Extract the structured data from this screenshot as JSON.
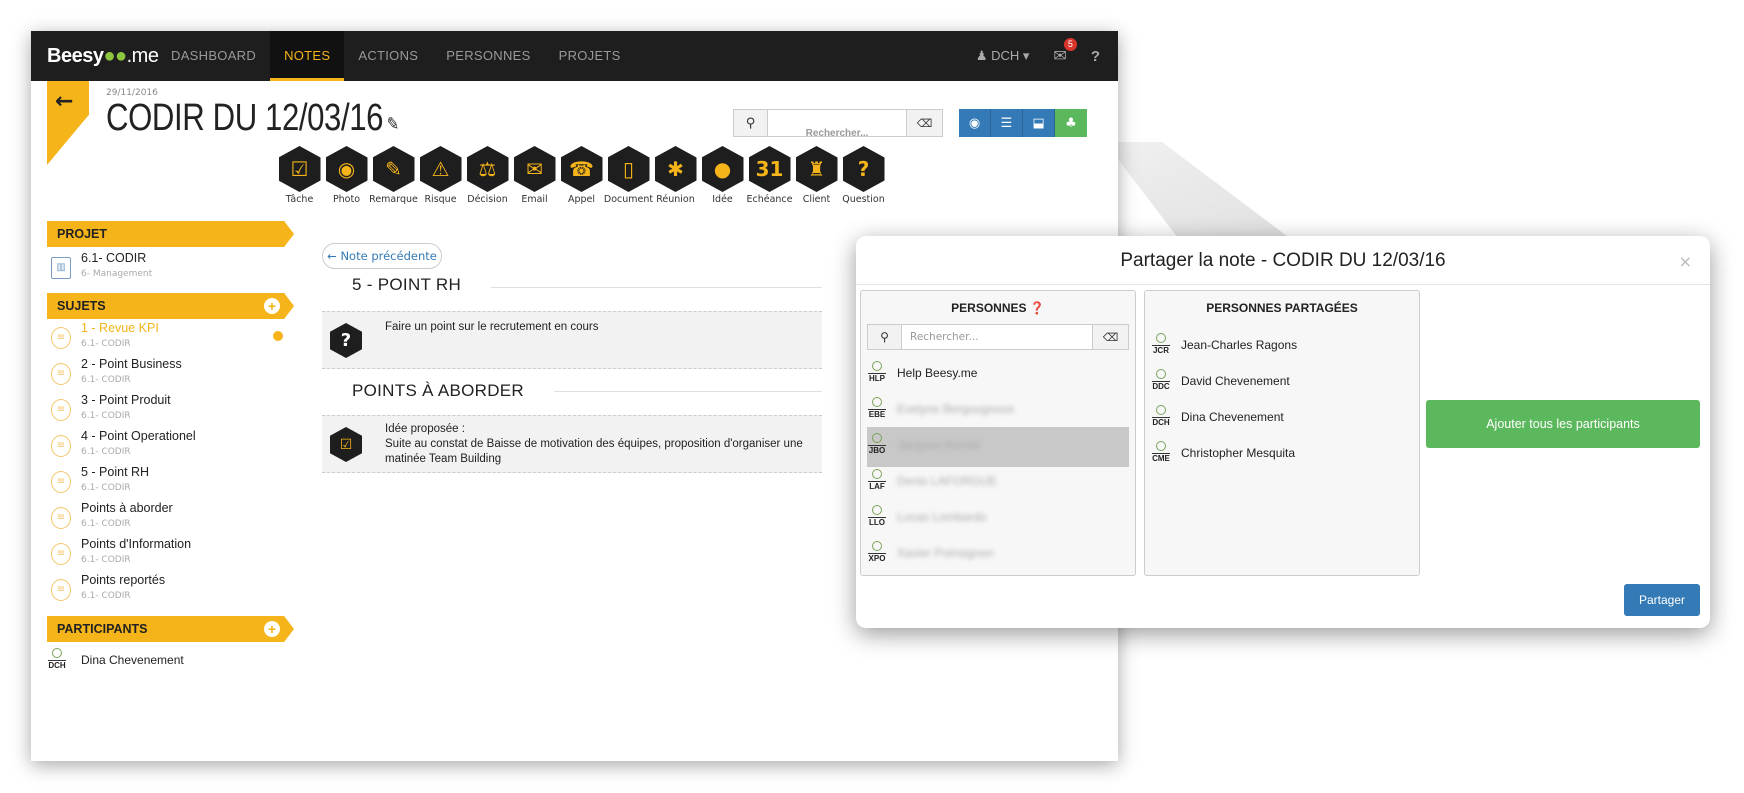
{
  "nav": {
    "logo": "Beesy",
    "logo_dots": "●●",
    "logo_me": ".me",
    "items": [
      "DASHBOARD",
      "NOTES",
      "ACTIONS",
      "PERSONNES",
      "PROJETS"
    ],
    "active": "NOTES",
    "user": "DCH ▾",
    "mail_count": "5"
  },
  "header": {
    "date": "29/11/2016",
    "title": "CODIR DU 12/03/16",
    "search_placeholder": "Rechercher..."
  },
  "tools": [
    "Tâche",
    "Photo",
    "Remarque",
    "Risque",
    "Décision",
    "Email",
    "Appel",
    "Document",
    "Réunion",
    "Idée",
    "Echéance",
    "Client",
    "Question"
  ],
  "tool_glyphs": [
    "☑",
    "◉",
    "✎",
    "⚠",
    "⚖",
    "✉",
    "☎",
    "▯",
    "✱",
    "●",
    "31",
    "♜",
    "?"
  ],
  "sidebar": {
    "projet_label": "PROJET",
    "projet_name": "6.1- CODIR",
    "projet_sub": "6- Management",
    "sujets_label": "SUJETS",
    "sujets": [
      {
        "name": "1 - Revue KPI",
        "sub": "6.1- CODIR"
      },
      {
        "name": "2 - Point Business",
        "sub": "6.1- CODIR"
      },
      {
        "name": "3 - Point Produit",
        "sub": "6.1- CODIR"
      },
      {
        "name": "4 - Point Operationel",
        "sub": "6.1- CODIR"
      },
      {
        "name": "5 - Point RH",
        "sub": "6.1- CODIR"
      },
      {
        "name": "Points à aborder",
        "sub": "6.1- CODIR"
      },
      {
        "name": "Points d'Information",
        "sub": "6.1- CODIR"
      },
      {
        "name": "Points reportés",
        "sub": "6.1- CODIR"
      }
    ],
    "participants_label": "PARTICIPANTS",
    "participant": {
      "initials": "DCH",
      "name": "Dina Chevenement"
    }
  },
  "main": {
    "prev_note": "← Note précédente",
    "section1": "5 - POINT RH",
    "card1_text": "Faire un point sur le recrutement en cours",
    "section2": "POINTS À ABORDER",
    "card2_line1": "Idée proposée :",
    "card2_line2": "Suite au constat de Baisse de motivation des équipes, proposition d'organiser une",
    "card2_line3": "matinée Team Building"
  },
  "modal": {
    "title": "Partager la note - CODIR DU 12/03/16",
    "close": "×",
    "personnes_label": "PERSONNES ❓",
    "search_placeholder": "Rechercher...",
    "personnes": [
      {
        "initials": "HLP",
        "name": "Help Beesy.me"
      },
      {
        "initials": "EBE",
        "name": "Evelyne Bergougnoux"
      },
      {
        "initials": "JBO",
        "name": "Jacques Bordel"
      },
      {
        "initials": "LAF",
        "name": "Denis LAFORGUE"
      },
      {
        "initials": "LLO",
        "name": "Lucas Lombardo"
      },
      {
        "initials": "XPO",
        "name": "Xavier Poinsignon"
      }
    ],
    "partagees_label": "PERSONNES PARTAGÉES",
    "partagees": [
      {
        "initials": "JCR",
        "name": "Jean-Charles Ragons"
      },
      {
        "initials": "DDC",
        "name": "David Chevenement"
      },
      {
        "initials": "DCH",
        "name": "Dina Chevenement"
      },
      {
        "initials": "CME",
        "name": "Christopher Mesquita"
      }
    ],
    "add_all": "Ajouter tous les participants",
    "share": "Partager"
  },
  "colors": {
    "accent": "#f4b41a",
    "primary": "#337ab7",
    "success": "#5cb85c",
    "navbar": "#1e1e1e"
  }
}
